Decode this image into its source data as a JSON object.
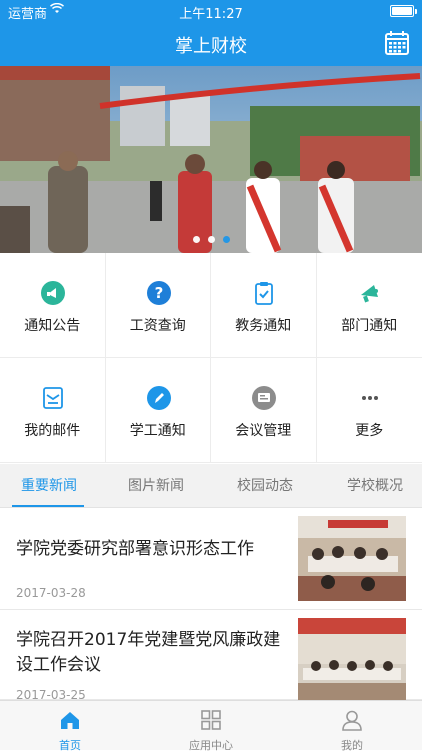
{
  "status_bar": {
    "carrier": "运营商",
    "time": "上午11:27"
  },
  "nav": {
    "title": "掌上财校",
    "right_icon": "calendar-icon"
  },
  "banner": {
    "slide_count": 3,
    "active_slide": 2
  },
  "grid": [
    {
      "label": "通知公告",
      "icon": "megaphone-icon",
      "color": "#2bb59a"
    },
    {
      "label": "工资查询",
      "icon": "question-icon",
      "color": "#1e7fd8"
    },
    {
      "label": "教务通知",
      "icon": "clipboard-check-icon",
      "color": "#1e96e8"
    },
    {
      "label": "部门通知",
      "icon": "bullhorn-icon",
      "color": "#2bb59a"
    },
    {
      "label": "我的邮件",
      "icon": "mail-icon",
      "color": "#1e96e8"
    },
    {
      "label": "学工通知",
      "icon": "pen-icon",
      "color": "#1e96e8"
    },
    {
      "label": "会议管理",
      "icon": "meeting-icon",
      "color": "#8c8c8c"
    },
    {
      "label": "更多",
      "icon": "more-icon",
      "color": "#555555"
    }
  ],
  "tabs": [
    {
      "label": "重要新闻",
      "active": true
    },
    {
      "label": "图片新闻",
      "active": false
    },
    {
      "label": "校园动态",
      "active": false
    },
    {
      "label": "学校概况",
      "active": false
    }
  ],
  "news": [
    {
      "title": "学院党委研究部署意识形态工作",
      "date": "2017-03-28"
    },
    {
      "title": "学院召开2017年党建暨党风廉政建设工作会议",
      "date": "2017-03-25"
    }
  ],
  "tabbar": [
    {
      "label": "首页",
      "icon": "home-icon",
      "active": true
    },
    {
      "label": "应用中心",
      "icon": "grid-icon",
      "active": false
    },
    {
      "label": "我的",
      "icon": "user-icon",
      "active": false
    }
  ],
  "colors": {
    "primary": "#1e96e8",
    "tab_bg": "#f2f2f2"
  }
}
